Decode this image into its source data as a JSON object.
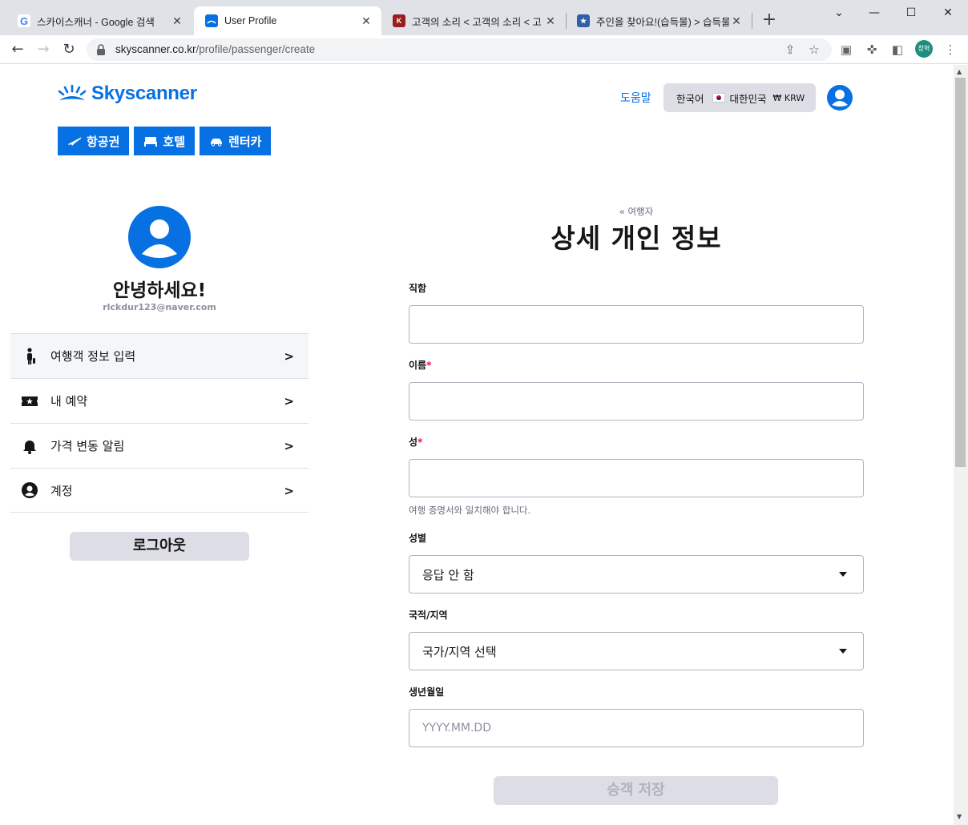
{
  "browser": {
    "tabs": [
      {
        "title": "스카이스캐너 - Google 검색",
        "favicon": "google-icon"
      },
      {
        "title": "User Profile",
        "favicon": "skyscanner-icon"
      },
      {
        "title": "고객의 소리 < 고객의 소리 < 고",
        "favicon": "kac-icon"
      },
      {
        "title": "주인을 찾아요!(습득물) > 습득물",
        "favicon": "police-icon"
      }
    ],
    "url_host": "skyscanner.co.kr",
    "url_path": "/profile/passenger/create",
    "profile_label": "창혁"
  },
  "header": {
    "logo_text": "Skyscanner",
    "help_label": "도움말",
    "locale": {
      "language": "한국어",
      "country": "대한민국",
      "currency": "₩ KRW"
    },
    "nav": [
      {
        "label": "항공권",
        "icon": "plane-icon"
      },
      {
        "label": "호텔",
        "icon": "bed-icon"
      },
      {
        "label": "렌터카",
        "icon": "car-icon"
      }
    ]
  },
  "sidebar": {
    "greeting": "안녕하세요!",
    "email": "rlckdur123@naver.com",
    "menu": [
      {
        "label": "여행객 정보 입력",
        "icon": "traveller-icon"
      },
      {
        "label": "내 예약",
        "icon": "ticket-icon"
      },
      {
        "label": "가격 변동 알림",
        "icon": "bell-icon"
      },
      {
        "label": "계정",
        "icon": "account-icon"
      }
    ],
    "logout_label": "로그아웃"
  },
  "form": {
    "breadcrumb": "« 여행자",
    "title": "상세 개인 정보",
    "fields": {
      "job_title": {
        "label": "직함",
        "value": ""
      },
      "first_name": {
        "label": "이름",
        "required": "*",
        "value": ""
      },
      "last_name": {
        "label": "성",
        "required": "*",
        "value": "",
        "hint": "여행 증명서와 일치해야 합니다."
      },
      "gender": {
        "label": "성별",
        "value": "응답 안 함"
      },
      "nationality": {
        "label": "국적/지역",
        "value": "국가/지역 선택"
      },
      "birthdate": {
        "label": "생년월일",
        "placeholder": "YYYY.MM.DD"
      }
    },
    "save_label": "승객 저장"
  },
  "colors": {
    "brand": "#0770e3",
    "required": "#e70866",
    "button_disabled": "#dddde5"
  }
}
